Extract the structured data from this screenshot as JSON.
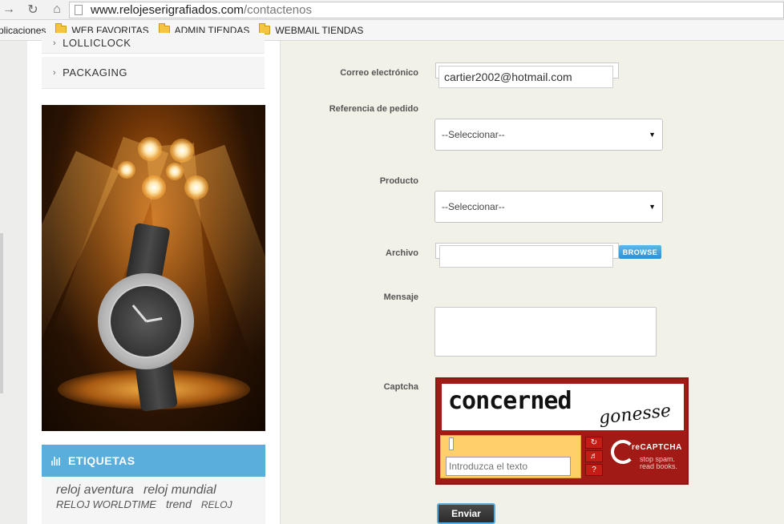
{
  "browser": {
    "url_domain": "www.relojeserigrafiados.com",
    "url_path": "/contactenos",
    "bookmarks": [
      "plicaciones",
      "WEB FAVORITAS",
      "ADMIN TIENDAS",
      "WEBMAIL TIENDAS"
    ]
  },
  "sidebar": {
    "categories": [
      {
        "label": "LOLLICLOCK"
      },
      {
        "label": "PACKAGING"
      }
    ],
    "tags": {
      "title": "ETIQUETAS",
      "items": [
        "reloj aventura",
        "reloj mundial",
        "RELOJ WORLDTIME",
        "trend",
        "RELOJ"
      ]
    }
  },
  "form": {
    "email": {
      "label": "Correo electrónico",
      "value": "cartier2002@hotmail.com"
    },
    "order_ref": {
      "label": "Referencia de pedido",
      "selected": "--Seleccionar--"
    },
    "product": {
      "label": "Producto",
      "selected": "--Seleccionar--"
    },
    "file": {
      "label": "Archivo",
      "button": "BROWSE"
    },
    "message": {
      "label": "Mensaje"
    },
    "captcha": {
      "label": "Captcha",
      "word1": "concerned",
      "word2": "gonesse",
      "placeholder": "Introduzca el texto",
      "brand": "reCAPTCHA",
      "tagline1": "stop spam.",
      "tagline2": "read books."
    },
    "submit": "Enviar"
  }
}
